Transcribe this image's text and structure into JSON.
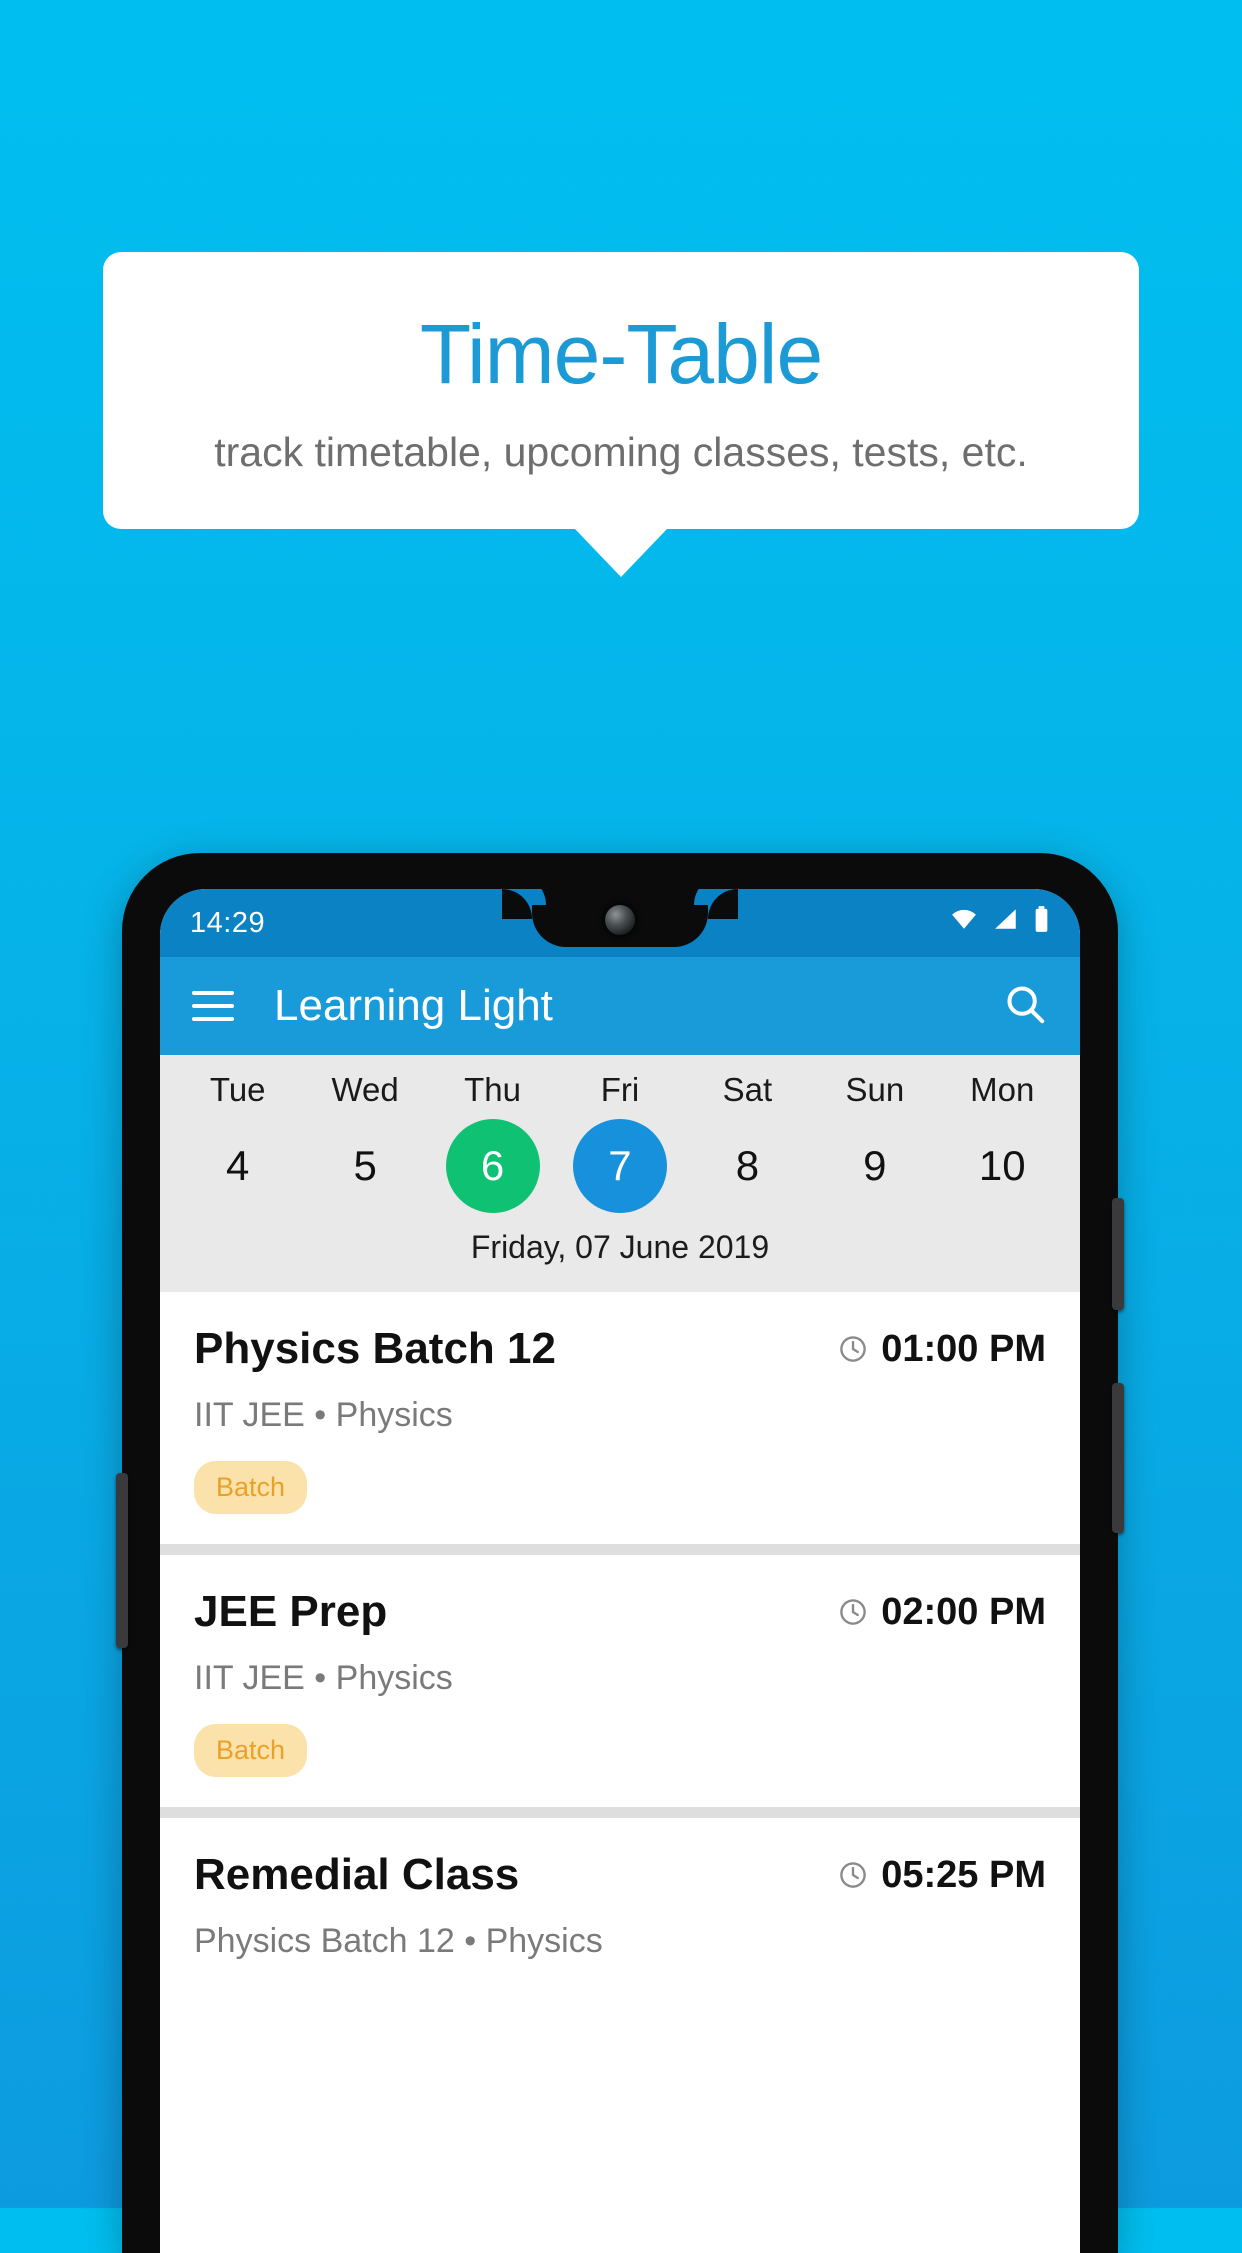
{
  "promo": {
    "title": "Time-Table",
    "subtitle": "track timetable, upcoming classes, tests, etc."
  },
  "colors": {
    "background_top": "#00BFF0",
    "background_bottom": "#0D9BDF",
    "title": "#1B9AD6",
    "appbar": "#189BD8",
    "statusbar": "#0B82C4",
    "today_green": "#0FC173",
    "selected_blue": "#1791DC",
    "badge_bg": "#FBE2AA",
    "badge_text": "#E9A227"
  },
  "phone": {
    "statusbar": {
      "time": "14:29",
      "icons": [
        "wifi-icon",
        "signal-icon",
        "battery-icon"
      ]
    },
    "appbar": {
      "menu_icon": "hamburger-menu-icon",
      "title": "Learning Light",
      "search_icon": "search-icon"
    },
    "datestrip": {
      "days": [
        {
          "day": "Tue",
          "num": "4",
          "state": "normal"
        },
        {
          "day": "Wed",
          "num": "5",
          "state": "normal"
        },
        {
          "day": "Thu",
          "num": "6",
          "state": "today"
        },
        {
          "day": "Fri",
          "num": "7",
          "state": "selected"
        },
        {
          "day": "Sat",
          "num": "8",
          "state": "normal"
        },
        {
          "day": "Sun",
          "num": "9",
          "state": "normal"
        },
        {
          "day": "Mon",
          "num": "10",
          "state": "normal"
        }
      ],
      "selected_date_label": "Friday, 07 June 2019"
    },
    "events": [
      {
        "title": "Physics Batch 12",
        "time": "01:00 PM",
        "subtitle": "IIT JEE • Physics",
        "badge": "Batch"
      },
      {
        "title": "JEE Prep",
        "time": "02:00 PM",
        "subtitle": "IIT JEE • Physics",
        "badge": "Batch"
      },
      {
        "title": "Remedial Class",
        "time": "05:25 PM",
        "subtitle": "Physics Batch 12 • Physics",
        "badge": ""
      }
    ]
  }
}
